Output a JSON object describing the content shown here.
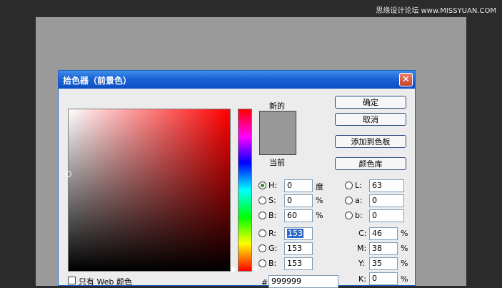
{
  "watermark": "思缘设计论坛  www.MISSYUAN.COM",
  "dialog": {
    "title": "拾色器（前景色）",
    "close_icon": "close-icon"
  },
  "swatch": {
    "new_label": "新的",
    "current_label": "当前",
    "color": "#999999"
  },
  "buttons": {
    "ok": "确定",
    "cancel": "取消",
    "add_swatch": "添加到色板",
    "libraries": "颜色库"
  },
  "hsb": {
    "h_label": "H:",
    "h_value": "0",
    "h_unit": "度",
    "s_label": "S:",
    "s_value": "0",
    "s_unit": "%",
    "b_label": "B:",
    "b_value": "60",
    "b_unit": "%"
  },
  "rgb": {
    "r_label": "R:",
    "r_value": "153",
    "g_label": "G:",
    "g_value": "153",
    "b_label": "B:",
    "b_value": "153"
  },
  "lab": {
    "l_label": "L:",
    "l_value": "63",
    "a_label": "a:",
    "a_value": "0",
    "b_label": "b:",
    "b_value": "0"
  },
  "cmyk": {
    "c_label": "C:",
    "c_value": "46",
    "c_unit": "%",
    "m_label": "M:",
    "m_value": "38",
    "m_unit": "%",
    "y_label": "Y:",
    "y_value": "35",
    "y_unit": "%",
    "k_label": "K:",
    "k_value": "0",
    "k_unit": "%"
  },
  "hex": {
    "label": "#",
    "value": "999999"
  },
  "web_only": {
    "label": "只有 Web 颜色",
    "checked": false
  },
  "selected_mode": "H"
}
